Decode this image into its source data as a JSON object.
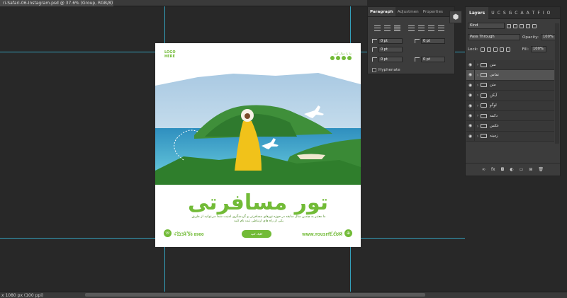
{
  "window": {
    "doc_tab": "ri-Safari-06-Instagram.psd @ 37.6% (Group, RGB/8)",
    "status": "x 1080 px (100 ppi)"
  },
  "document": {
    "logo": "LOGO\nHERE",
    "social_text": "ما را دنبال کنید",
    "title": "تور مسافرتی",
    "description": "ما معتبر به چندین سال سابقه در حوزه تورهای مسافرتی و گردشگری امنیت شما می‌توانید از طریق یکی از راه های ارتباطی ثبت نام کنید",
    "contact_left_label": "اطلاعات تماس",
    "contact_left_value": "+1234 56 8900",
    "cta": "کلیک کنید",
    "contact_right_label": "ثبت نام کنید",
    "contact_right_value": "WWW.YOUSITE.COM"
  },
  "paragraph_panel": {
    "tabs": [
      "Paragraph",
      "Adjustmen",
      "Properties"
    ],
    "fields": [
      "0 pt",
      "0 pt",
      "0 pt",
      "0 pt",
      "0 pt"
    ],
    "hyphenate": "Hyphenate"
  },
  "layers_panel": {
    "tab": "Layers",
    "filters": [
      "U",
      "C",
      "S",
      "G",
      "C",
      "A",
      "A",
      "T",
      "F",
      "I",
      "O"
    ],
    "kind": "Kind",
    "blend_mode": "Pass Through",
    "opacity_label": "Opacity:",
    "opacity_value": "100%",
    "lock_label": "Lock:",
    "fill_label": "Fill:",
    "fill_value": "100%",
    "layers": [
      "متن",
      "تماس",
      "متن",
      "آیکن",
      "لوگو",
      "دکمه",
      "عکس",
      "زمینه"
    ]
  },
  "colors": {
    "accent": "#72bb37",
    "guide": "#36b4d4",
    "workspace": "#282828",
    "panel": "#3c3c3c"
  }
}
